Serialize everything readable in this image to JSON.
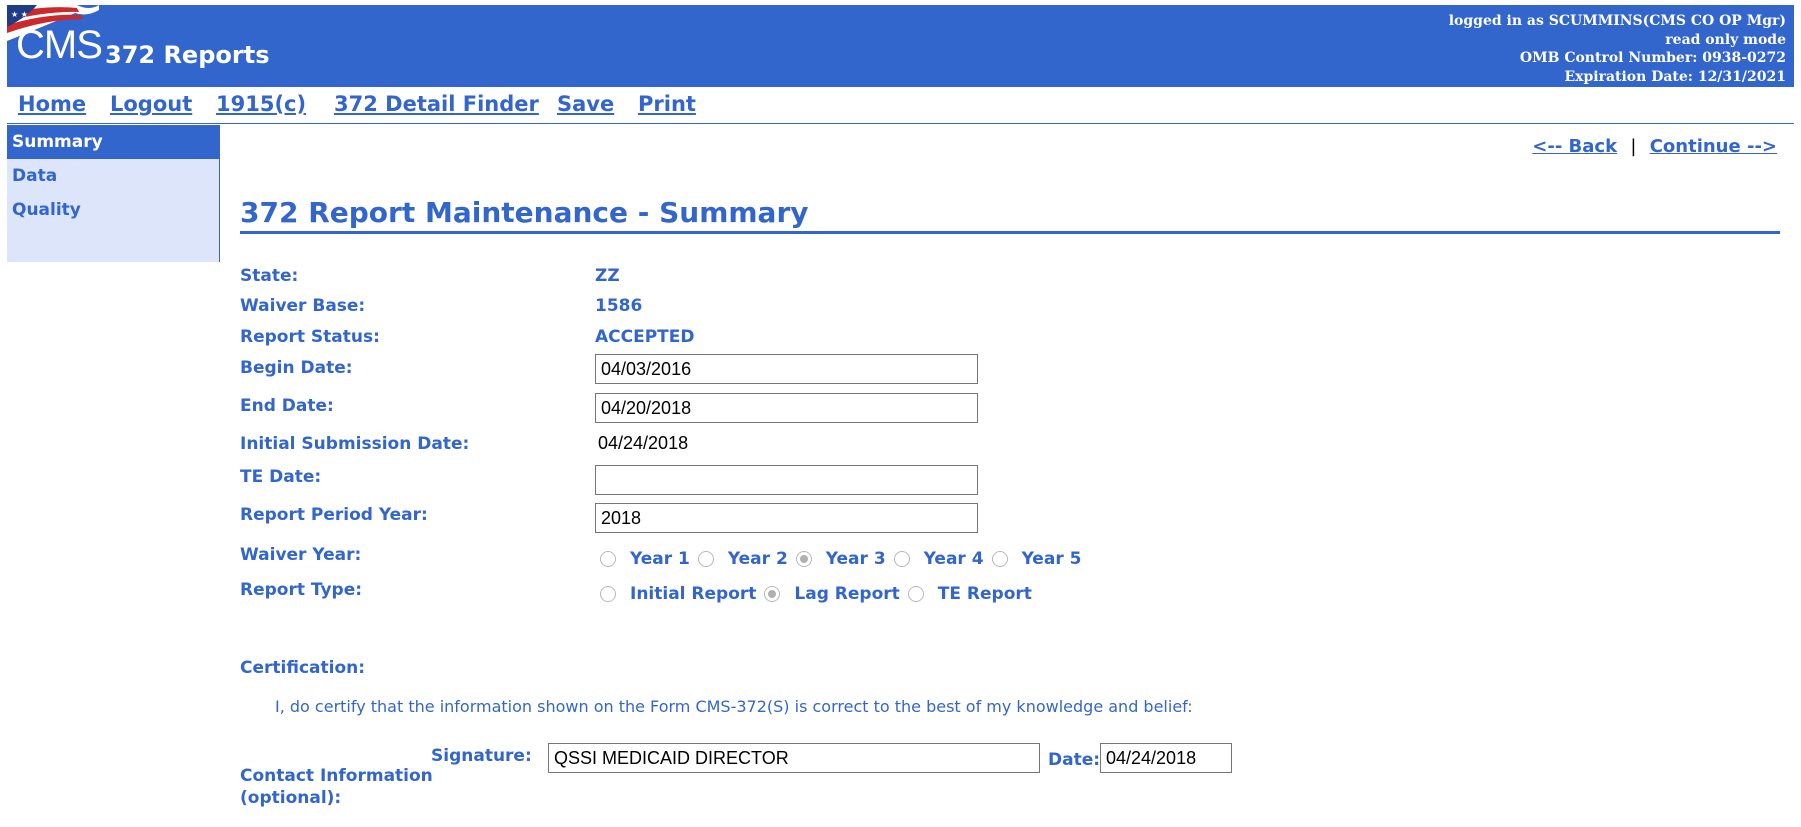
{
  "header": {
    "logo_text": "CMS",
    "app_title": "372 Reports",
    "user_line": "logged in as SCUMMINS(CMS CO OP Mgr)",
    "mode_line": "read only mode",
    "omb_line": "OMB Control Number: 0938-0272",
    "expiration_line": "Expiration Date: 12/31/2021"
  },
  "nav": {
    "home": "Home",
    "logout": "Logout",
    "c1915": "1915(c)",
    "detail_finder": "372 Detail Finder",
    "save": "Save",
    "print": "Print"
  },
  "sidebar": {
    "items": [
      {
        "label": "Summary",
        "active": true
      },
      {
        "label": "Data",
        "active": false
      },
      {
        "label": "Quality",
        "active": false
      }
    ]
  },
  "paging": {
    "back": "<-- Back",
    "separator": "|",
    "continue": "Continue -->"
  },
  "page": {
    "title": "372 Report Maintenance - Summary"
  },
  "form": {
    "state_label": "State:",
    "state_value": "ZZ",
    "waiver_base_label": "Waiver Base:",
    "waiver_base_value": "1586",
    "report_status_label": "Report Status:",
    "report_status_value": "ACCEPTED",
    "begin_date_label": "Begin Date:",
    "begin_date_value": "04/03/2016",
    "end_date_label": "End Date:",
    "end_date_value": "04/20/2018",
    "initial_submission_label": "Initial Submission Date:",
    "initial_submission_value": "04/24/2018",
    "te_date_label": "TE Date:",
    "te_date_value": "",
    "report_period_year_label": "Report Period Year:",
    "report_period_year_value": "2018",
    "waiver_year_label": "Waiver Year:",
    "waiver_year_options": [
      {
        "label": "Year 1",
        "checked": false
      },
      {
        "label": "Year 2",
        "checked": false
      },
      {
        "label": "Year 3",
        "checked": true
      },
      {
        "label": "Year 4",
        "checked": false
      },
      {
        "label": "Year 5",
        "checked": false
      }
    ],
    "report_type_label": "Report Type:",
    "report_type_options": [
      {
        "label": "Initial Report",
        "checked": false
      },
      {
        "label": "Lag Report",
        "checked": true
      },
      {
        "label": "TE Report",
        "checked": false
      }
    ]
  },
  "certification": {
    "label": "Certification:",
    "statement": "I, do certify that the information shown on the Form CMS-372(S) is correct to the best of my knowledge and belief:",
    "signature_label": "Signature:",
    "signature_value": "QSSI MEDICAID DIRECTOR",
    "date_label": "Date:",
    "date_value": "04/24/2018",
    "contact_label_1": "Contact Information",
    "contact_label_2": "(optional):"
  }
}
